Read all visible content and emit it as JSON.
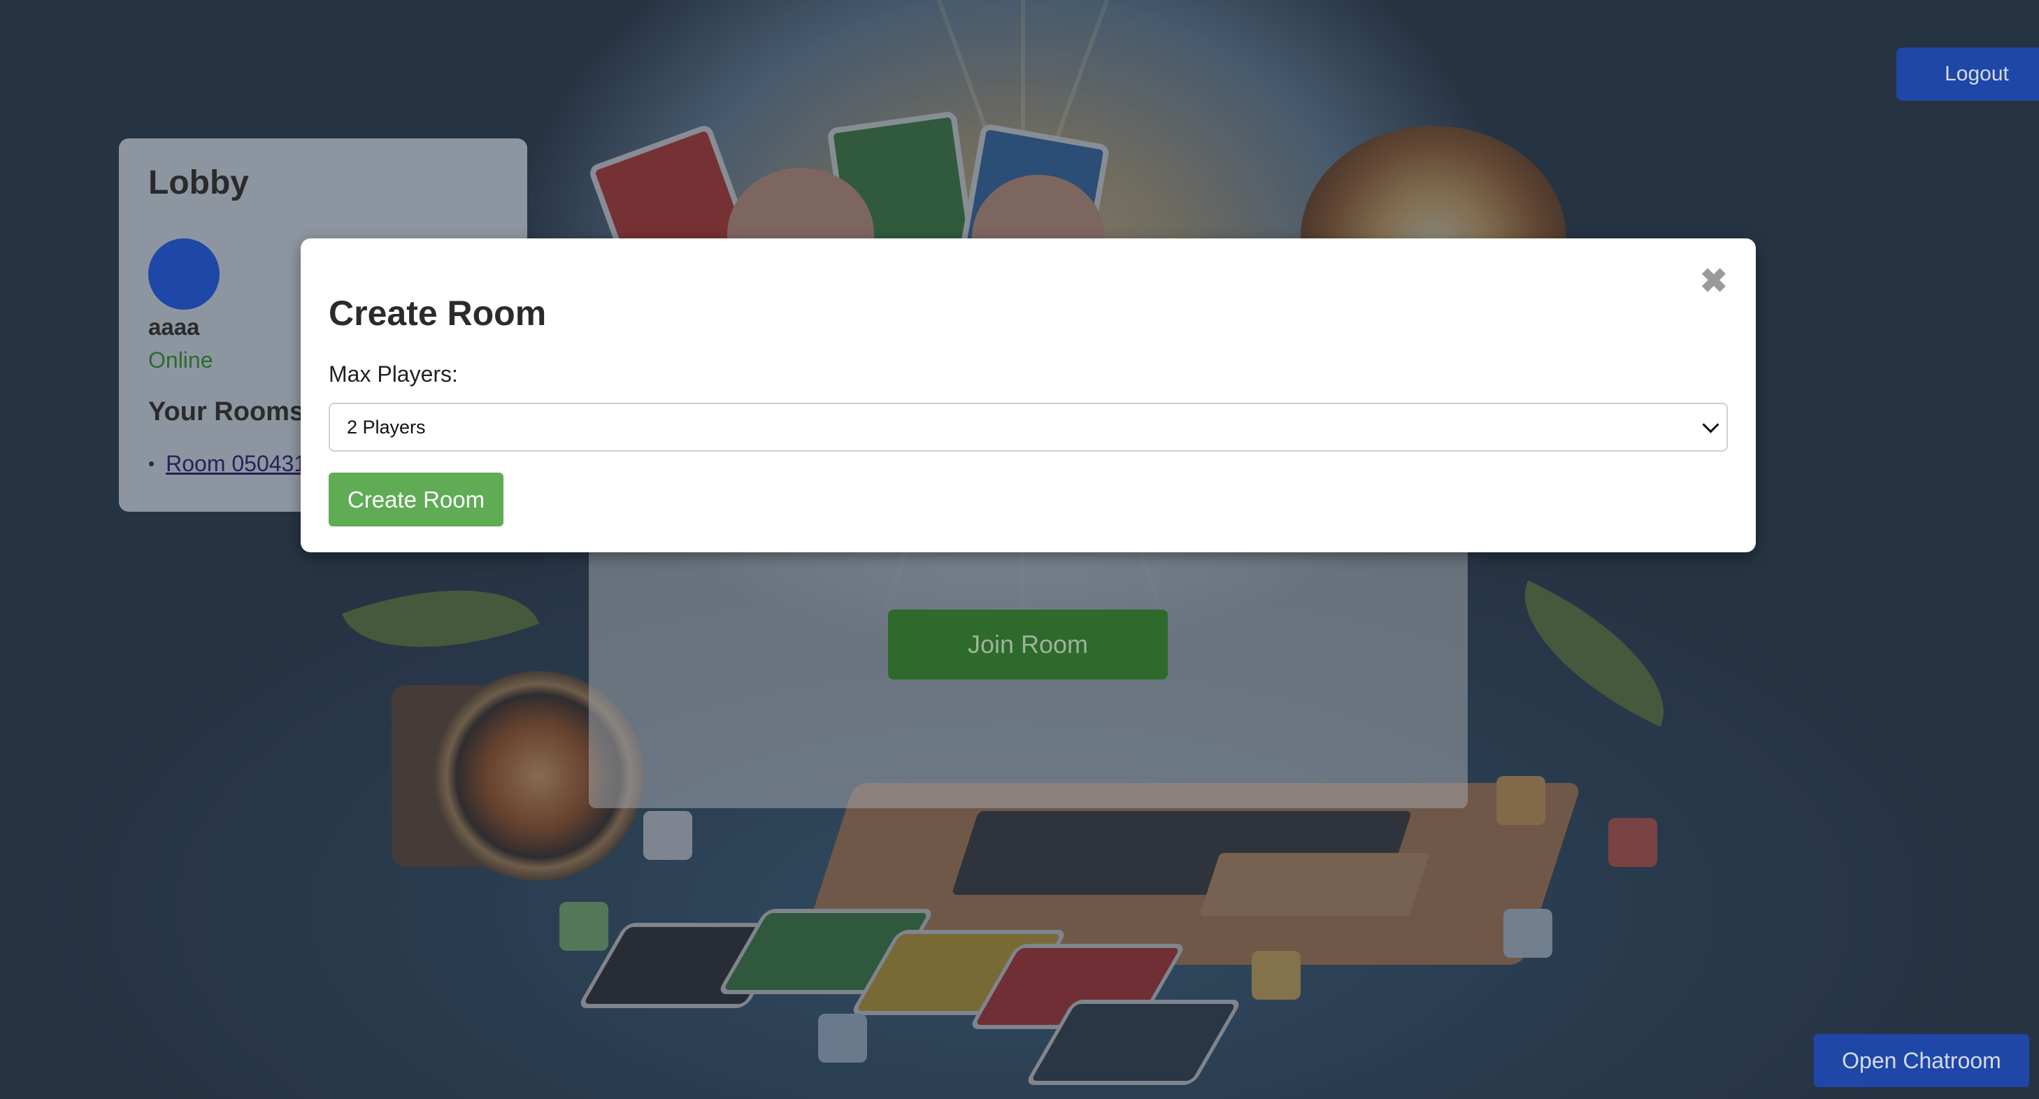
{
  "header": {
    "logout_label": "Logout"
  },
  "lobby": {
    "title": "Lobby",
    "user": {
      "name": "aaaa",
      "status": "Online"
    },
    "rooms_heading": "Your Rooms",
    "rooms": [
      {
        "label": "Room 050431"
      }
    ]
  },
  "main": {
    "join_room_label": "Join Room"
  },
  "modal": {
    "title": "Create Room",
    "close_glyph": "✖",
    "max_players_label": "Max Players:",
    "max_players_value": "2 Players",
    "submit_label": "Create Room"
  },
  "chat": {
    "open_label": "Open Chatroom"
  },
  "colors": {
    "primary": "#1e47a7",
    "success": "#5fac55",
    "status_online": "#2f6a2e"
  }
}
